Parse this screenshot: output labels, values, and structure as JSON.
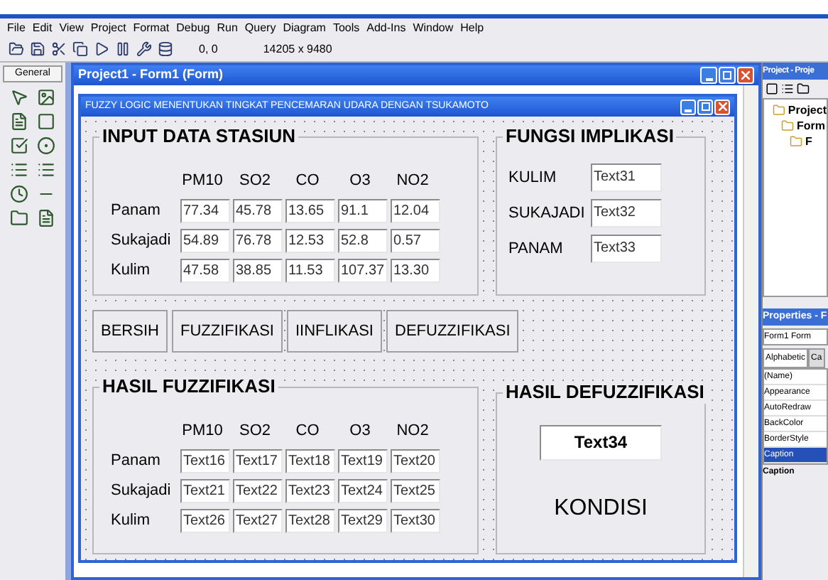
{
  "menu": [
    "File",
    "Edit",
    "View",
    "Project",
    "Format",
    "Debug",
    "Run",
    "Query",
    "Diagram",
    "Tools",
    "Add-Ins",
    "Window",
    "Help"
  ],
  "toolbar": {
    "position": "0, 0",
    "size": "14205 x 9480"
  },
  "toolbox": {
    "title": "General"
  },
  "mdi_window": {
    "title": "Project1 - Form1 (Form)"
  },
  "form": {
    "title": "FUZZY LOGIC MENENTUKAN TINGKAT PENCEMARAN UDARA DENGAN TSUKAMOTO",
    "input_group": {
      "title": "INPUT DATA STASIUN",
      "columns": [
        "PM10",
        "SO2",
        "CO",
        "O3",
        "NO2"
      ],
      "rows": [
        {
          "label": "Panam",
          "values": [
            "77.34",
            "45.78",
            "13.65",
            "91.1",
            "12.04"
          ]
        },
        {
          "label": "Sukajadi",
          "values": [
            "54.89",
            "76.78",
            "12.53",
            "52.8",
            "0.57"
          ]
        },
        {
          "label": "Kulim",
          "values": [
            "47.58",
            "38.85",
            "11.53",
            "107.37",
            "13.30"
          ]
        }
      ]
    },
    "implication_group": {
      "title": "FUNGSI IMPLIKASI",
      "rows": [
        {
          "label": "KULIM",
          "value": "Text31"
        },
        {
          "label": "SUKAJADI",
          "value": "Text32"
        },
        {
          "label": "PANAM",
          "value": "Text33"
        }
      ]
    },
    "buttons": [
      "BERSIH",
      "FUZZIFIKASI",
      "IINFLIKASI",
      "DEFUZZIFIKASI"
    ],
    "fuzzification_group": {
      "title": "HASIL FUZZIFIKASI",
      "columns": [
        "PM10",
        "SO2",
        "CO",
        "O3",
        "NO2"
      ],
      "rows": [
        {
          "label": "Panam",
          "values": [
            "Text16",
            "Text17",
            "Text18",
            "Text19",
            "Text20"
          ]
        },
        {
          "label": "Sukajadi",
          "values": [
            "Text21",
            "Text22",
            "Text23",
            "Text24",
            "Text25"
          ]
        },
        {
          "label": "Kulim",
          "values": [
            "Text26",
            "Text27",
            "Text28",
            "Text29",
            "Text30"
          ]
        }
      ]
    },
    "defuzzification_group": {
      "title": "HASIL DEFUZZIFIKASI",
      "value": "Text34",
      "caption": "KONDISI"
    }
  },
  "project_panel": {
    "title": "Project - Proje",
    "tree": [
      {
        "label": "Project",
        "children": [
          {
            "label": "Form",
            "children": [
              {
                "label": "F"
              }
            ]
          }
        ]
      }
    ]
  },
  "properties_panel": {
    "title": "Properties - F",
    "object": "Form1 Form",
    "tabs": [
      {
        "label": "Alphabetic",
        "selected": true
      },
      {
        "label": "Ca",
        "selected": false
      }
    ],
    "rows": [
      {
        "label": "(Name)",
        "selected": false
      },
      {
        "label": "Appearance",
        "selected": false
      },
      {
        "label": "AutoRedraw",
        "selected": false
      },
      {
        "label": "BackColor",
        "selected": false
      },
      {
        "label": "BorderStyle",
        "selected": false
      },
      {
        "label": "Caption",
        "selected": true
      }
    ],
    "description": "Caption"
  }
}
